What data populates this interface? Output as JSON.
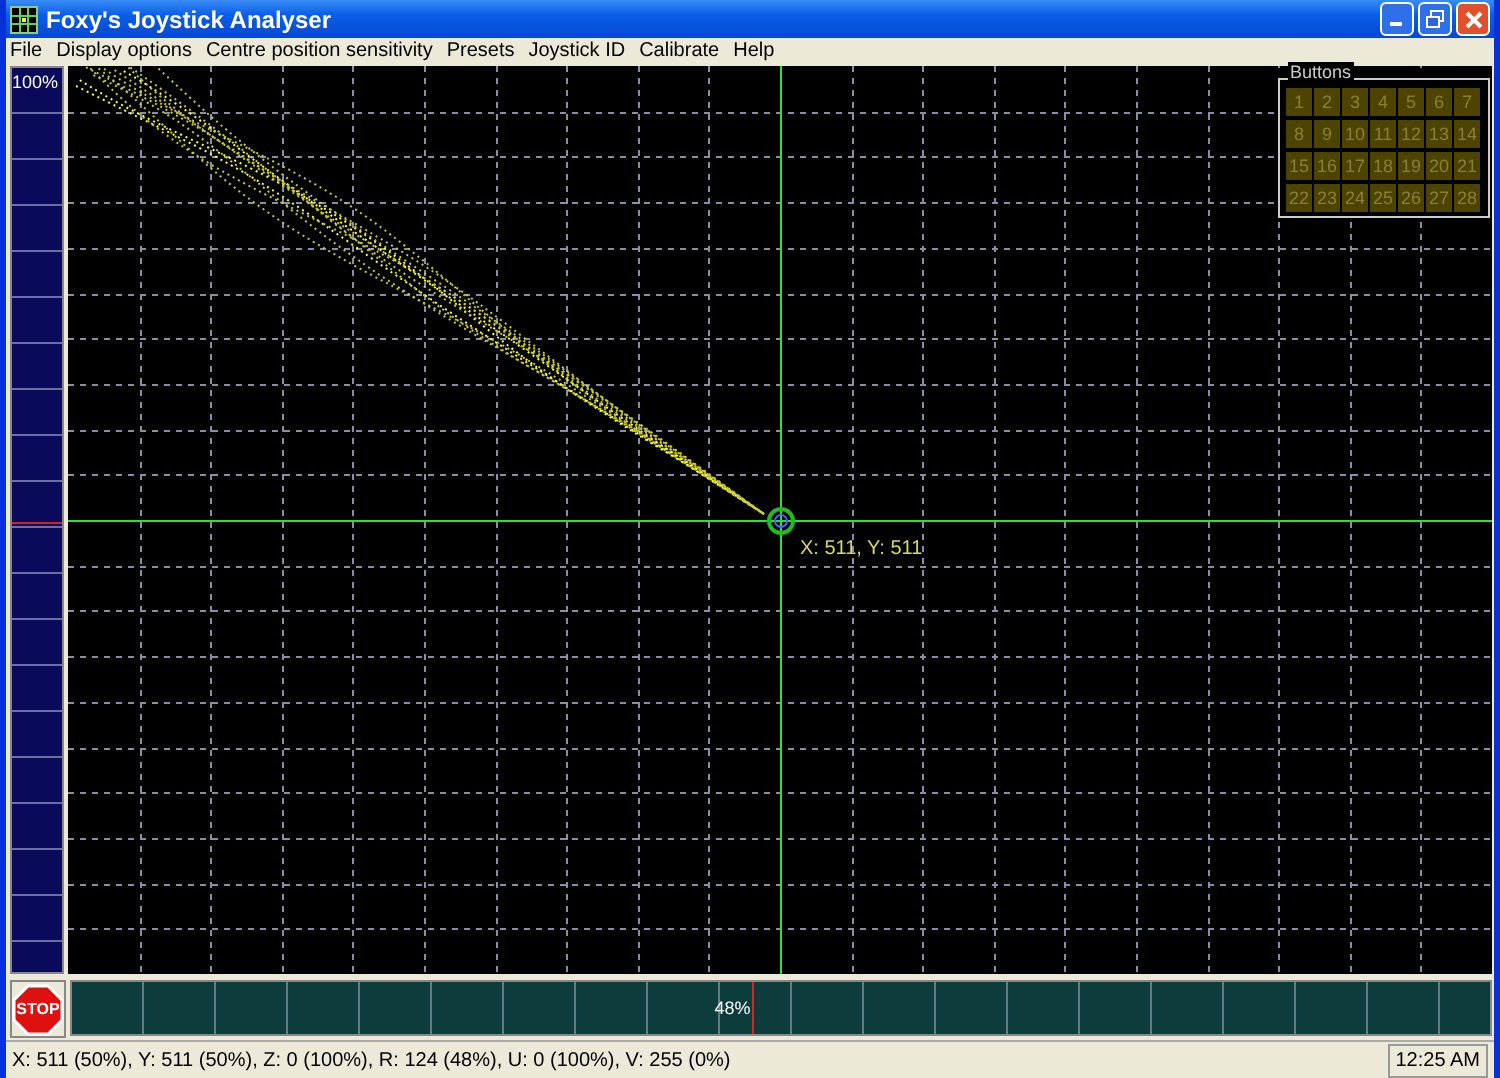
{
  "window": {
    "title": "Foxy's Joystick Analyser"
  },
  "menu": [
    "File",
    "Display options",
    "Centre position sensitivity",
    "Presets",
    "Joystick ID",
    "Calibrate",
    "Help"
  ],
  "throttle_meter": {
    "label": "100%",
    "level": 1
  },
  "plot": {
    "position_label": "X: 511, Y: 511"
  },
  "buttons_panel": {
    "title": "Buttons",
    "buttons": [
      "1",
      "2",
      "3",
      "4",
      "5",
      "6",
      "7",
      "8",
      "9",
      "10",
      "11",
      "12",
      "13",
      "14",
      "15",
      "16",
      "17",
      "18",
      "19",
      "20",
      "21",
      "22",
      "23",
      "24",
      "25",
      "26",
      "27",
      "28"
    ]
  },
  "stop_button": {
    "label": "STOP"
  },
  "rudder_meter": {
    "label": "48%",
    "level": 0.48
  },
  "status_bar": {
    "readout": "X: 511 (50%), Y: 511 (50%), Z: 0 (100%), R: 124 (48%), U: 0 (100%), V: 255 (0%)",
    "clock": "12:25 AM"
  }
}
